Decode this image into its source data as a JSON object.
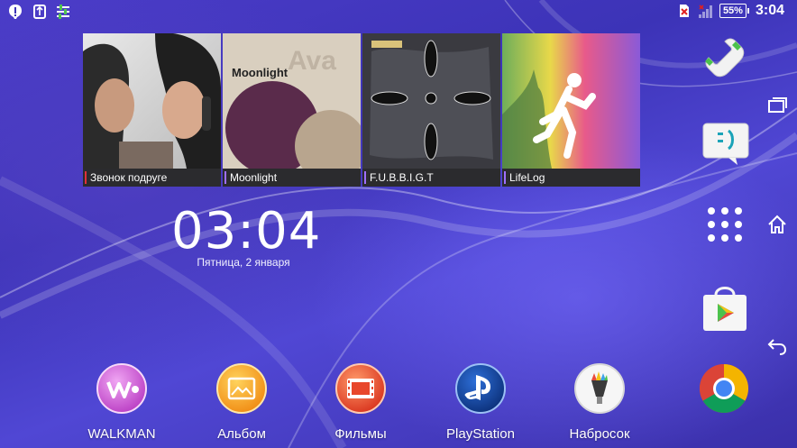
{
  "status_bar": {
    "notification_icons": [
      "alert-icon",
      "sync-icon",
      "settings-sliders-icon"
    ],
    "battery_percent": "55%",
    "battery_level": 0.55,
    "time": "3:04"
  },
  "album_widget": {
    "tiles": [
      {
        "caption": "Звонок подруге",
        "accent": "#e0303a"
      },
      {
        "caption": "Moonlight",
        "accent": "#a070ff",
        "art_text_1": "Moonlight",
        "art_text_2": "Ava"
      },
      {
        "caption": "F.U.B.B.I.G.T",
        "accent": "#a070ff"
      },
      {
        "caption": "LifeLog",
        "accent": "#a070ff"
      }
    ]
  },
  "clock_widget": {
    "time": "03:04",
    "date": "Пятница, 2 января"
  },
  "dock": {
    "items": [
      {
        "label": "WALKMAN",
        "icon": "walkman-icon"
      },
      {
        "label": "Альбом",
        "icon": "album-icon"
      },
      {
        "label": "Фильмы",
        "icon": "movies-icon"
      },
      {
        "label": "PlayStation",
        "icon": "playstation-icon"
      },
      {
        "label": "Набросок",
        "icon": "sketch-icon"
      },
      {
        "label": "",
        "icon": "chrome-icon"
      }
    ]
  },
  "side_apps": [
    "phone-icon",
    "messaging-icon",
    "app-drawer-icon",
    "play-store-icon"
  ],
  "nav_buttons": [
    "recent-apps-icon",
    "home-icon",
    "back-icon"
  ],
  "colors": {
    "wallpaper": "#4b3cc8",
    "caption_bar": "#2b2b2e",
    "album_accent": "#f6a21c",
    "movies_accent": "#e8472b",
    "playstation_blue": "#0b3b8f"
  }
}
